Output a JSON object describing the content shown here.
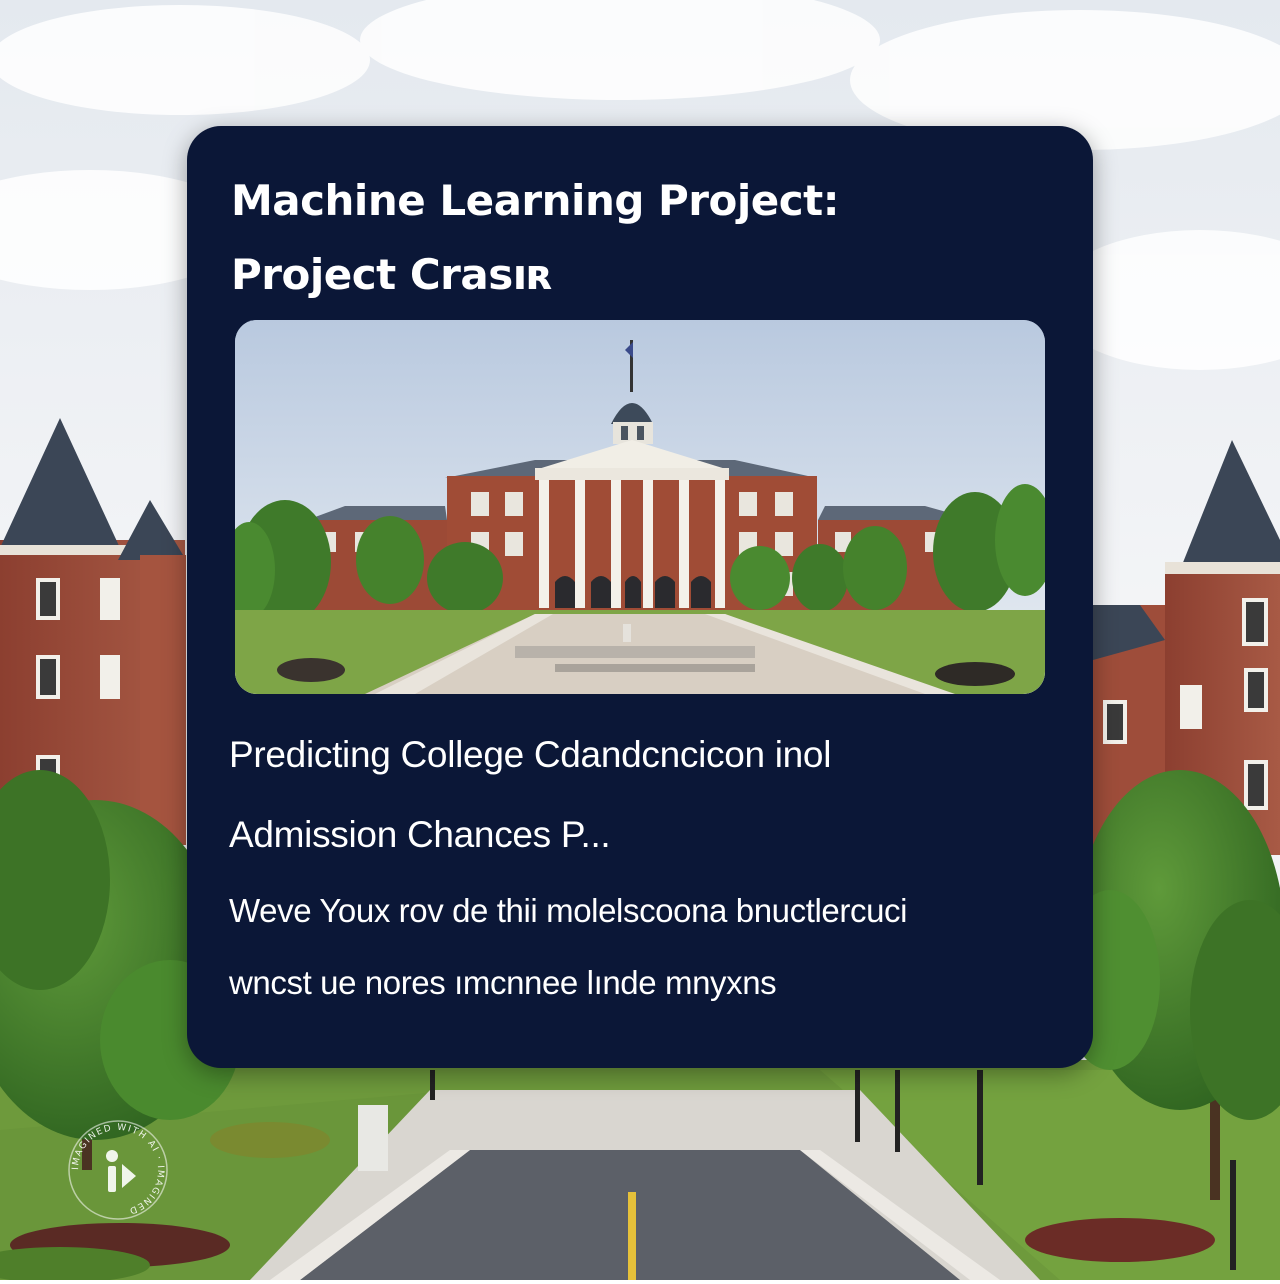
{
  "card": {
    "title_line_1": "Machine Learning Project:",
    "title_line_2": "Project Crasıʀ",
    "subtitle_line_1": "Predicting College Cdandcncicon inol",
    "subtitle_line_2": "Admission Chances P...",
    "body_line_1": "Weve Youx rov de thii molelscoona bnuctlercuci",
    "body_line_2": "wncst ue  nores ımcnnee lınde mnyxns"
  },
  "watermark": {
    "text": "IMAGINED WITH AI · IMAGINED",
    "icon": "imagined-logo-icon"
  },
  "colors": {
    "card_bg": "#0b1737",
    "sky": "#eef1f5",
    "brick": "#9a4a3a",
    "grass": "#6e9a3c",
    "tree": "#3f7a2a",
    "road": "#5c6068",
    "roof": "#3b4656"
  }
}
